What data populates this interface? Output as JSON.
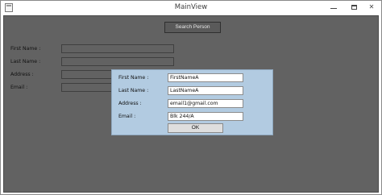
{
  "window": {
    "title": "MainView",
    "minimize_label": "",
    "maximize_label": "",
    "close_label": "✕"
  },
  "toolbar": {
    "search_label": "Search Person"
  },
  "form": {
    "first_name_label": "First Name :",
    "last_name_label": "Last Name :",
    "address_label": "Address :",
    "email_label": "Email :",
    "first_name_value": "",
    "last_name_value": "",
    "address_value": "",
    "email_value": ""
  },
  "dialog": {
    "first_name_label": "First Name :",
    "last_name_label": "Last Name :",
    "address_label": "Address :",
    "email_label": "Email :",
    "first_name_value": "FirstNameA",
    "last_name_value": "LastNameA",
    "address_value": "email1@gmail.com",
    "email_value": "Blk 244/A",
    "ok_label": "OK"
  },
  "colors": {
    "client_background": "#626262",
    "dialog_background": "#b2cbe1"
  }
}
